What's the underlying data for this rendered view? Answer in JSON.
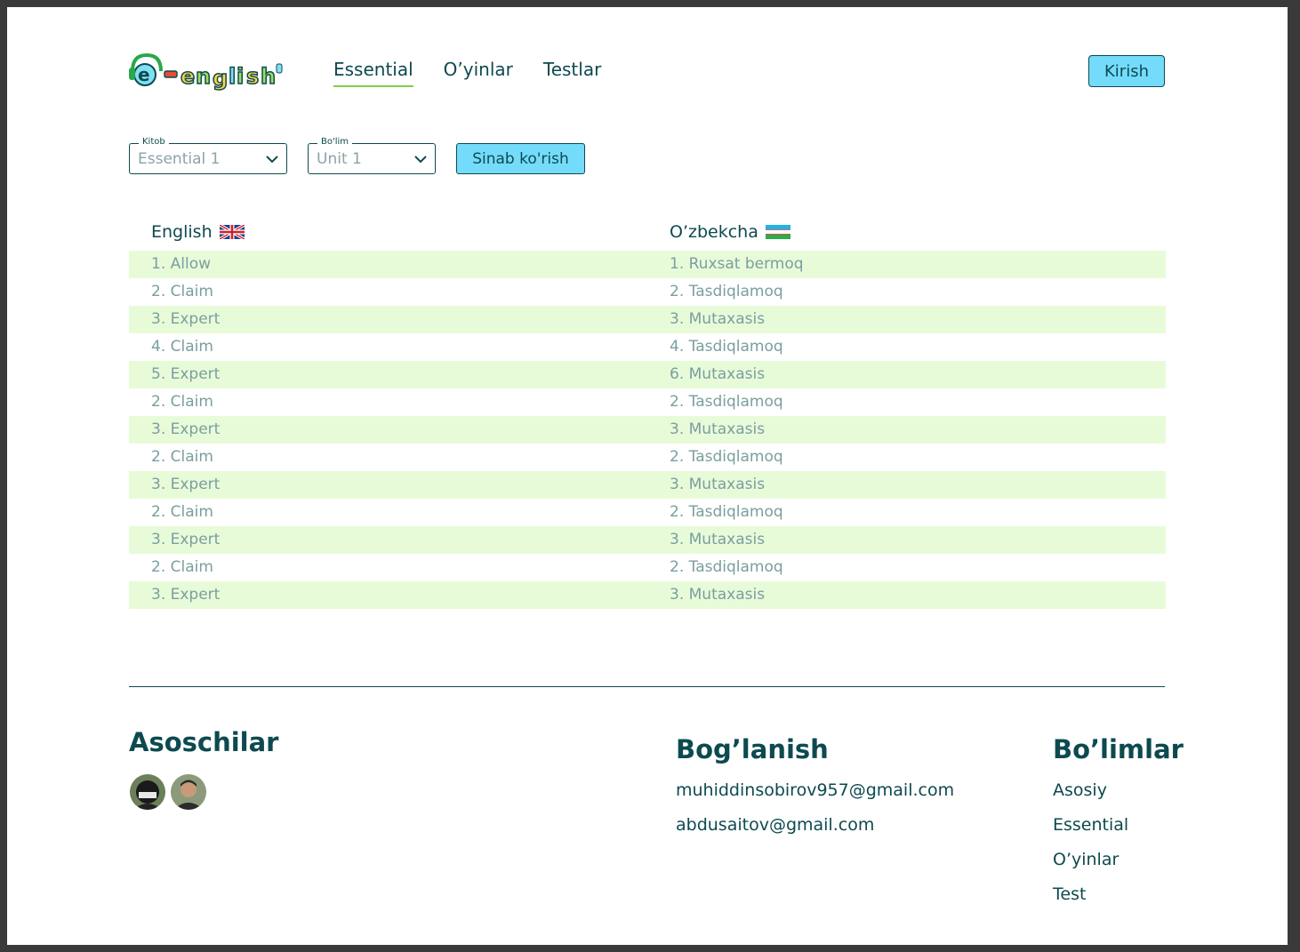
{
  "header": {
    "logo_text": "e-english",
    "nav": [
      {
        "label": "Essential",
        "active": true
      },
      {
        "label": "O’yinlar",
        "active": false
      },
      {
        "label": "Testlar",
        "active": false
      }
    ],
    "login_label": "Kirish"
  },
  "filters": {
    "book": {
      "legend": "Kitob",
      "value": "Essential 1"
    },
    "section": {
      "legend": "Bo'lim",
      "value": "Unit 1"
    },
    "try_label": "Sinab ko'rish"
  },
  "table": {
    "headers": {
      "english": "English",
      "uzbek": "O’zbekcha"
    },
    "rows": [
      {
        "en": "1. Allow",
        "uz": "1. Ruxsat bermoq"
      },
      {
        "en": "2. Claim",
        "uz": "2. Tasdiqlamoq"
      },
      {
        "en": "3. Expert",
        "uz": "3. Mutaxasis"
      },
      {
        "en": "4. Claim",
        "uz": "4. Tasdiqlamoq"
      },
      {
        "en": "5. Expert",
        "uz": "6. Mutaxasis"
      },
      {
        "en": "2. Claim",
        "uz": "2. Tasdiqlamoq"
      },
      {
        "en": "3. Expert",
        "uz": "3. Mutaxasis"
      },
      {
        "en": "2. Claim",
        "uz": "2. Tasdiqlamoq"
      },
      {
        "en": "3. Expert",
        "uz": "3. Mutaxasis"
      },
      {
        "en": "2. Claim",
        "uz": "2. Tasdiqlamoq"
      },
      {
        "en": "3. Expert",
        "uz": "3. Mutaxasis"
      },
      {
        "en": "2. Claim",
        "uz": "2. Tasdiqlamoq"
      },
      {
        "en": "3. Expert",
        "uz": "3. Mutaxasis"
      }
    ]
  },
  "footer": {
    "founders_title": "Asoschilar",
    "contact_title": "Bog’lanish",
    "contacts": [
      "muhiddinsobirov957@gmail.com",
      "abdusaitov@gmail.com"
    ],
    "sections_title": "Bo’limlar",
    "sections": [
      "Asosiy",
      "Essential",
      "O’yinlar",
      "Test"
    ]
  },
  "colors": {
    "text": "#0d4a4f",
    "muted": "#7a9ea0",
    "accent": "#74dcfa",
    "row_alt": "#e8fbd9",
    "nav_underline": "#7bd14a"
  }
}
